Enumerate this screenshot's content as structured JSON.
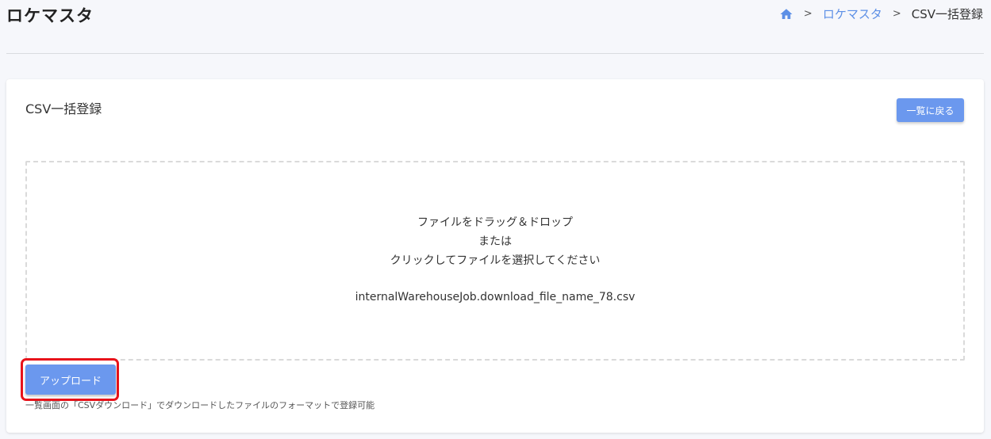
{
  "header": {
    "title": "ロケマスタ",
    "breadcrumb": {
      "home_icon": "home-icon",
      "link": "ロケマスタ",
      "current": "CSV一括登録",
      "separator": ">"
    }
  },
  "card": {
    "title": "CSV一括登録",
    "back_button": "一覧に戻る",
    "dropzone": {
      "line1": "ファイルをドラッグ＆ドロップ",
      "line2": "または",
      "line3": "クリックしてファイルを選択してください",
      "file_name": "internalWarehouseJob.download_file_name_78.csv"
    },
    "upload_button": "アップロード",
    "hint": "一覧画面の「CSVダウンロード」でダウンロードしたファイルのフォーマットで登録可能"
  },
  "colors": {
    "accent": "#6b98ee",
    "link": "#5c8fe6",
    "highlight": "#e8131b"
  }
}
